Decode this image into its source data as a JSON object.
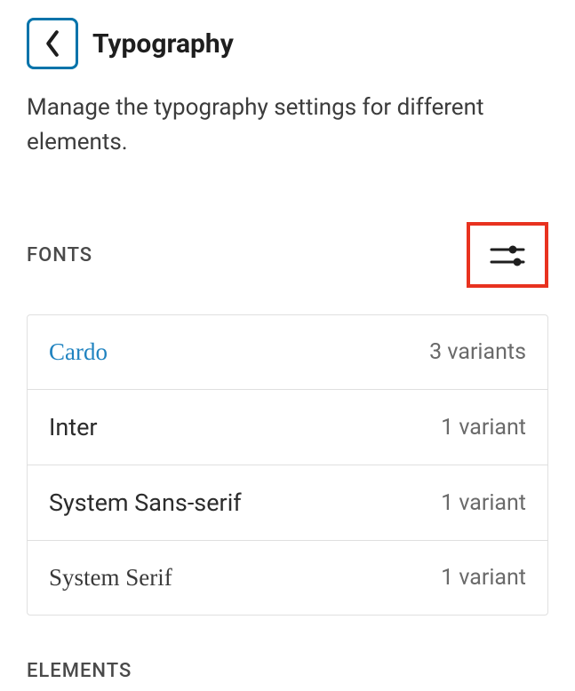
{
  "header": {
    "title": "Typography"
  },
  "description": "Manage the typography settings for different elements.",
  "fonts": {
    "label": "FONTS",
    "items": [
      {
        "name": "Cardo",
        "variants": "3 variants",
        "highlighted": true,
        "serif": true
      },
      {
        "name": "Inter",
        "variants": "1 variant",
        "highlighted": false,
        "serif": false
      },
      {
        "name": "System Sans-serif",
        "variants": "1 variant",
        "highlighted": false,
        "serif": false
      },
      {
        "name": "System Serif",
        "variants": "1 variant",
        "highlighted": false,
        "serif": true
      }
    ]
  },
  "elements": {
    "label": "ELEMENTS"
  }
}
